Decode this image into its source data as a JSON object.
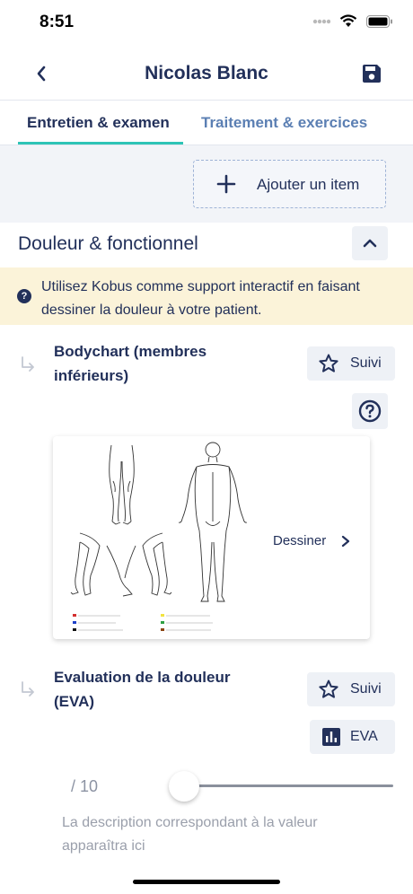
{
  "status": {
    "time": "8:51"
  },
  "nav": {
    "title": "Nicolas Blanc"
  },
  "tabs": [
    {
      "label": "Entretien & examen",
      "active": true
    },
    {
      "label": "Traitement & exercices",
      "active": false
    }
  ],
  "toolbar": {
    "add_item_label": "Ajouter un item"
  },
  "section": {
    "title": "Douleur & fonctionnel",
    "info": "Utilisez Kobus comme support interactif en faisant dessiner la douleur à votre patient."
  },
  "items": [
    {
      "title": "Bodychart (membres inférieurs)",
      "follow_label": "Suivi",
      "action_label": "Dessiner"
    },
    {
      "title": "Evaluation de la douleur (EVA)",
      "follow_label": "Suivi",
      "eva_label": "EVA"
    }
  ],
  "eva": {
    "scale": "/ 10",
    "value": 0,
    "max": 10,
    "description": "La description correspondant à la valeur apparaîtra ici"
  },
  "colors": {
    "accent": "#2ec4b6",
    "primary": "#22305a",
    "link": "#5b7fb3",
    "banner": "#fbf3d9"
  },
  "icons": [
    "back-chevron-icon",
    "save-icon",
    "plus-icon",
    "chevron-up-icon",
    "info-icon",
    "sub-item-arrow-icon",
    "star-icon",
    "help-icon",
    "chevron-right-icon",
    "bar-chart-icon"
  ]
}
